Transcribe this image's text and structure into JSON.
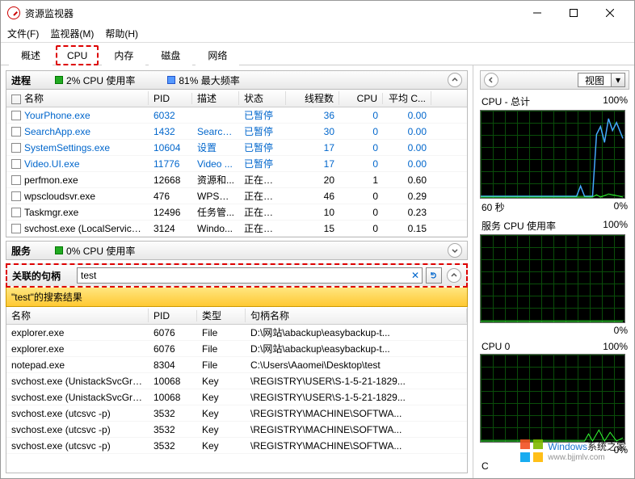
{
  "window": {
    "title": "资源监视器"
  },
  "menu": {
    "file": "文件(F)",
    "monitor": "监视器(M)",
    "help": "帮助(H)"
  },
  "tabs": {
    "overview": "概述",
    "cpu": "CPU",
    "memory": "内存",
    "disk": "磁盘",
    "network": "网络"
  },
  "processes": {
    "title": "进程",
    "cpu_usage": "2% CPU 使用率",
    "max_freq": "81% 最大频率",
    "cols": {
      "name": "名称",
      "pid": "PID",
      "desc": "描述",
      "status": "状态",
      "threads": "线程数",
      "cpu": "CPU",
      "avg": "平均 C..."
    },
    "rows": [
      {
        "name": "YourPhone.exe",
        "pid": "6032",
        "desc": "",
        "status": "已暂停",
        "threads": "36",
        "cpu": "0",
        "avg": "0.00",
        "link": true
      },
      {
        "name": "SearchApp.exe",
        "pid": "1432",
        "desc": "Search...",
        "status": "已暂停",
        "threads": "30",
        "cpu": "0",
        "avg": "0.00",
        "link": true
      },
      {
        "name": "SystemSettings.exe",
        "pid": "10604",
        "desc": "设置",
        "status": "已暂停",
        "threads": "17",
        "cpu": "0",
        "avg": "0.00",
        "link": true
      },
      {
        "name": "Video.UI.exe",
        "pid": "11776",
        "desc": "Video ...",
        "status": "已暂停",
        "threads": "17",
        "cpu": "0",
        "avg": "0.00",
        "link": true
      },
      {
        "name": "perfmon.exe",
        "pid": "12668",
        "desc": "资源和...",
        "status": "正在运行",
        "threads": "20",
        "cpu": "1",
        "avg": "0.60",
        "link": false
      },
      {
        "name": "wpscloudsvr.exe",
        "pid": "476",
        "desc": "WPS服...",
        "status": "正在运行",
        "threads": "46",
        "cpu": "0",
        "avg": "0.29",
        "link": false
      },
      {
        "name": "Taskmgr.exe",
        "pid": "12496",
        "desc": "任务管...",
        "status": "正在运行",
        "threads": "10",
        "cpu": "0",
        "avg": "0.23",
        "link": false
      },
      {
        "name": "svchost.exe (LocalServiceN...",
        "pid": "3124",
        "desc": "Windo...",
        "status": "正在运行",
        "threads": "15",
        "cpu": "0",
        "avg": "0.15",
        "link": false
      }
    ]
  },
  "services": {
    "title": "服务",
    "cpu_usage": "0% CPU 使用率"
  },
  "handles": {
    "title": "关联的句柄",
    "search_value": "test",
    "result_label": "\"test\"的搜索结果",
    "cols": {
      "name": "名称",
      "pid": "PID",
      "type": "类型",
      "handle": "句柄名称"
    },
    "rows": [
      {
        "name": "explorer.exe",
        "pid": "6076",
        "type": "File",
        "handle": "D:\\网站\\abackup\\easybackup-t..."
      },
      {
        "name": "explorer.exe",
        "pid": "6076",
        "type": "File",
        "handle": "D:\\网站\\abackup\\easybackup-t..."
      },
      {
        "name": "notepad.exe",
        "pid": "8304",
        "type": "File",
        "handle": "C:\\Users\\Aaomei\\Desktop\\test"
      },
      {
        "name": "svchost.exe (UnistackSvcGroup)",
        "pid": "10068",
        "type": "Key",
        "handle": "\\REGISTRY\\USER\\S-1-5-21-1829..."
      },
      {
        "name": "svchost.exe (UnistackSvcGroup)",
        "pid": "10068",
        "type": "Key",
        "handle": "\\REGISTRY\\USER\\S-1-5-21-1829..."
      },
      {
        "name": "svchost.exe (utcsvc -p)",
        "pid": "3532",
        "type": "Key",
        "handle": "\\REGISTRY\\MACHINE\\SOFTWA..."
      },
      {
        "name": "svchost.exe (utcsvc -p)",
        "pid": "3532",
        "type": "Key",
        "handle": "\\REGISTRY\\MACHINE\\SOFTWA..."
      },
      {
        "name": "svchost.exe (utcsvc -p)",
        "pid": "3532",
        "type": "Key",
        "handle": "\\REGISTRY\\MACHINE\\SOFTWA..."
      }
    ]
  },
  "right": {
    "view_label": "视图",
    "charts": [
      {
        "title": "CPU - 总计",
        "pct": "100%",
        "foot_l": "60 秒",
        "foot_r": "0%"
      },
      {
        "title": "服务 CPU 使用率",
        "pct": "100%",
        "foot_l": "",
        "foot_r": "0%"
      },
      {
        "title": "CPU 0",
        "pct": "100%",
        "foot_l": "",
        "foot_r": "0%"
      }
    ],
    "next_chart": "C"
  },
  "watermark": {
    "brand": "Windows",
    "suffix": "系统之家",
    "url": "www.bjjmlv.com"
  }
}
